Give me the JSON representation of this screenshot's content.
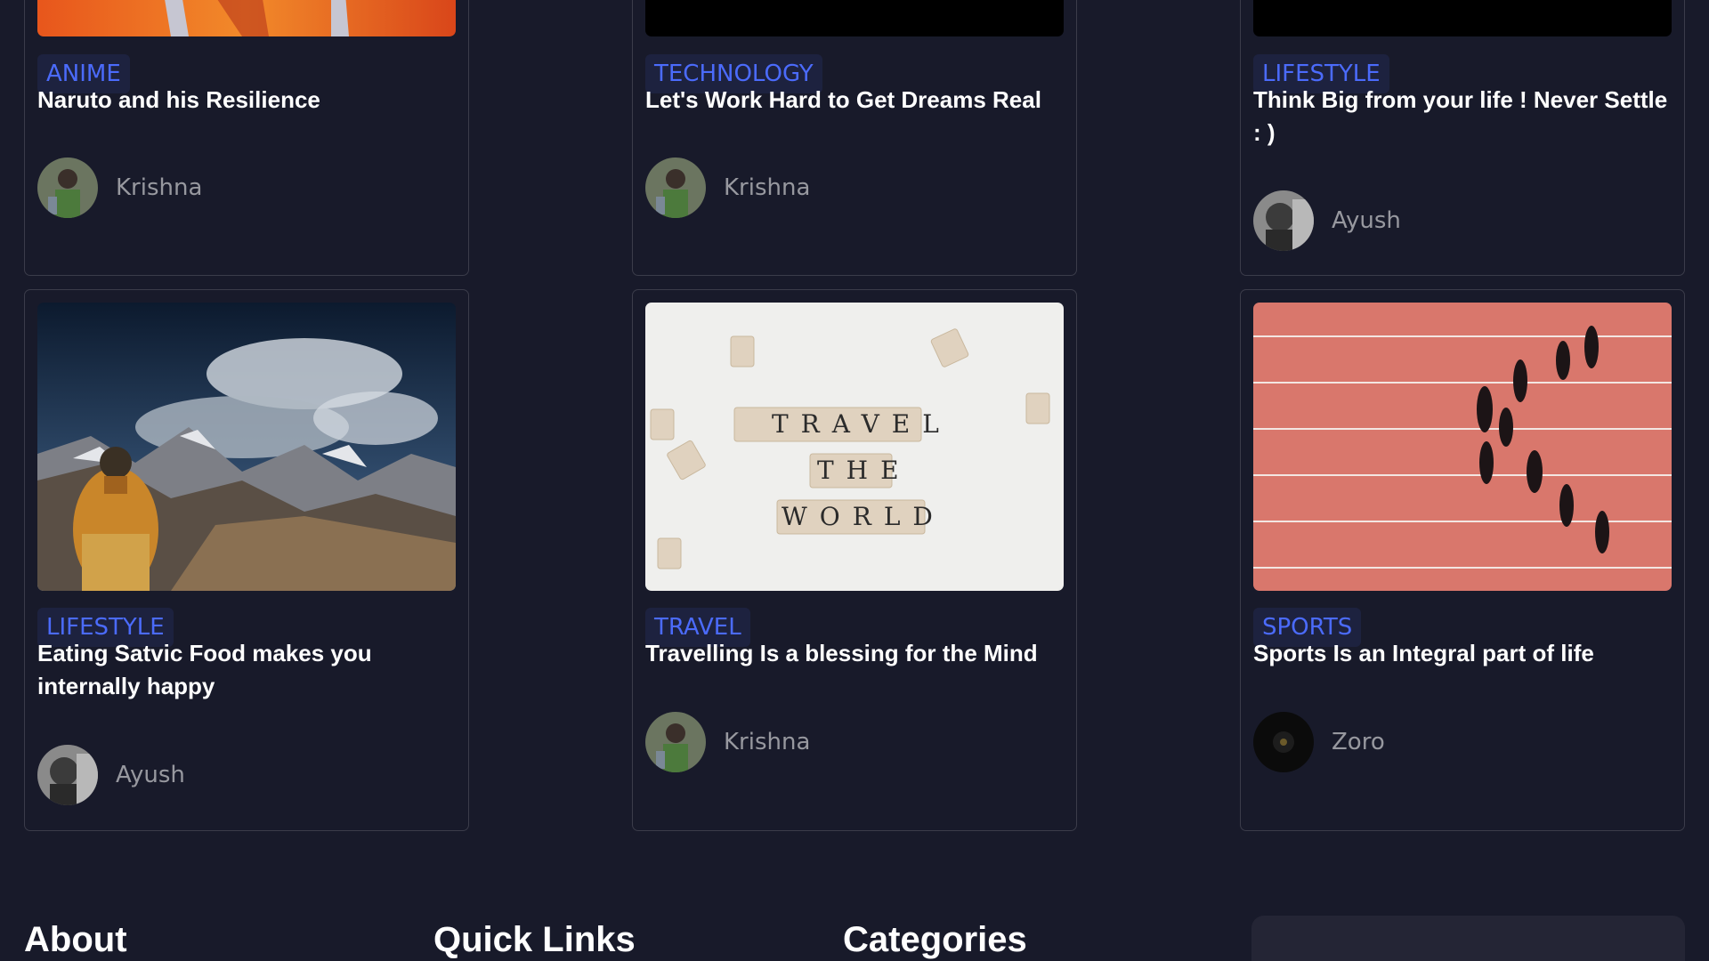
{
  "posts": [
    {
      "category": "ANIME",
      "title": "Naruto and his Resilience",
      "author": "Krishna",
      "image": "naruto-image"
    },
    {
      "category": "TECHNOLOGY",
      "title": "Let's Work Hard to Get Dreams Real",
      "author": "Krishna",
      "image": "dark-image"
    },
    {
      "category": "LIFESTYLE",
      "title": "Think Big from your life ! Never Settle : )",
      "author": "Ayush",
      "image": "dark-image"
    },
    {
      "category": "LIFESTYLE",
      "title": "Eating Satvic Food makes you internally happy",
      "author": "Ayush",
      "image": "buddha-mountains-image"
    },
    {
      "category": "TRAVEL",
      "title": "Travelling Is a blessing for the Mind",
      "author": "Krishna",
      "image": "scrabble-tiles-image",
      "image_text": {
        "line1": "TRAVEL",
        "line2": "THE",
        "line3": "WORLD"
      }
    },
    {
      "category": "SPORTS",
      "title": "Sports Is an Integral part of life",
      "author": "Zoro",
      "image": "running-track-image"
    }
  ],
  "footer": {
    "about_heading": "About",
    "quick_links_heading": "Quick Links",
    "categories_heading": "Categories"
  },
  "colors": {
    "background": "#181a2a",
    "card_border": "#3b3c4a",
    "badge_text": "#4b6bfb",
    "author_text": "#97989f",
    "newsletter_box": "#242535"
  }
}
